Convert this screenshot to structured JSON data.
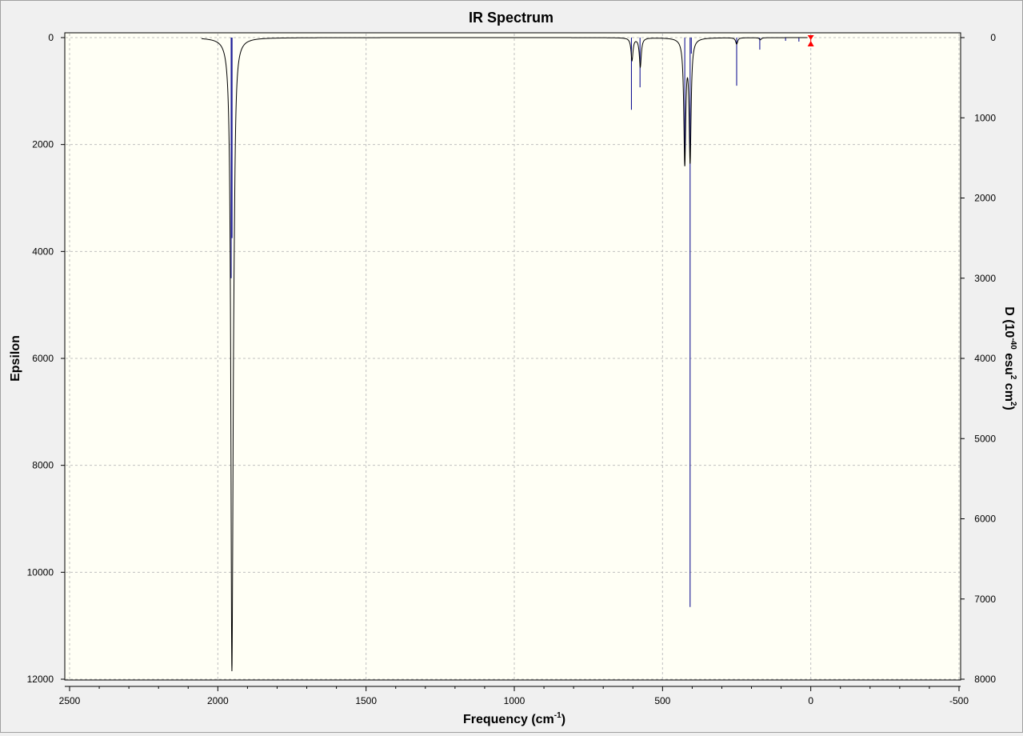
{
  "chart_data": {
    "type": "line",
    "title": "IR Spectrum",
    "xlabel": {
      "main": "Frequency (cm",
      "sup": "-1",
      "end": ")"
    },
    "ylabel_left": "Epsilon",
    "ylabel_right": {
      "a": "D (10",
      "sup1": "-40",
      "b": " esu",
      "sup2": "2",
      "c": " cm",
      "sup3": "2",
      "d": ")"
    },
    "xlim": [
      2500,
      -500
    ],
    "ylim_left": [
      0,
      12000
    ],
    "ylim_right": [
      0,
      8000
    ],
    "x_ticks": [
      2500,
      2000,
      1500,
      1000,
      500,
      0,
      -500
    ],
    "y_left_ticks": [
      0,
      2000,
      4000,
      6000,
      8000,
      10000,
      12000
    ],
    "y_right_ticks": [
      0,
      1000,
      2000,
      3000,
      4000,
      5000,
      6000,
      7000,
      8000
    ],
    "grid": true,
    "plot_background": "#fffff5",
    "colors": {
      "spectrum": "#000000",
      "sticks": "#00008b",
      "marker": "#ff0000",
      "grid": "#c0c0c0"
    },
    "series": [
      {
        "kind": "spectrum_curve",
        "hwhm": 4,
        "x_range": [
          2055,
          10
        ],
        "peaks": [
          {
            "x": 1953,
            "epsilon": 9450
          },
          {
            "x": 1950,
            "epsilon": 3200
          },
          {
            "x": 1945,
            "epsilon": 1100
          },
          {
            "x": 603,
            "epsilon": 420
          },
          {
            "x": 575,
            "epsilon": 540
          },
          {
            "x": 425,
            "epsilon": 2300
          },
          {
            "x": 407,
            "epsilon": 2250
          },
          {
            "x": 250,
            "epsilon": 120
          },
          {
            "x": 170,
            "epsilon": 40
          }
        ]
      },
      {
        "kind": "sticks",
        "axis": "right",
        "points": [
          {
            "x": 1955,
            "d": 3000
          },
          {
            "x": 1952,
            "d": 2500
          },
          {
            "x": 605,
            "d": 900
          },
          {
            "x": 576,
            "d": 620
          },
          {
            "x": 425,
            "d": 1550
          },
          {
            "x": 407,
            "d": 7100
          },
          {
            "x": 403,
            "d": 200
          },
          {
            "x": 250,
            "d": 600
          },
          {
            "x": 172,
            "d": 150
          },
          {
            "x": 85,
            "d": 40
          },
          {
            "x": 40,
            "d": 50
          }
        ]
      }
    ]
  }
}
